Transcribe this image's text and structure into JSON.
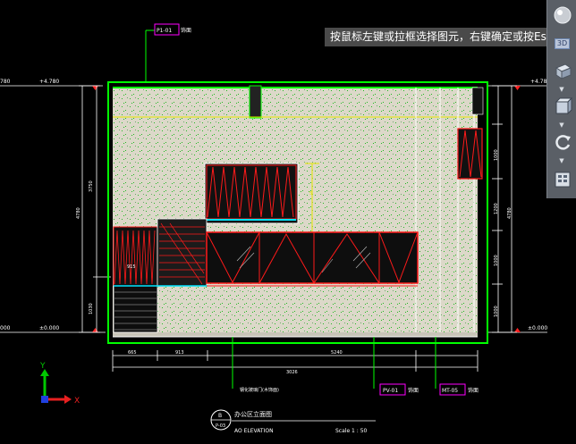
{
  "drawing": {
    "levels": {
      "top_left": "+4.780",
      "top_right": "+4.780",
      "floor_left": "±0.000",
      "floor_right": "±0.000",
      "top_left_far": "780",
      "floor_left_far": "000"
    },
    "left_dims": {
      "inner_upper": "3750",
      "outer_total": "4780",
      "inner_lower": "1030"
    },
    "right_dims": {
      "d1": "1000",
      "d2": "1200",
      "d3": "1000",
      "d4": "1000",
      "total": "4780"
    },
    "bottom_dims": {
      "d1": "665",
      "d2": "913",
      "d3": "5240",
      "d4": "3026"
    },
    "tags": {
      "top_material": "P1-01",
      "top_material_note": "饰面",
      "bottom_material_1": "PV-01",
      "bottom_material_1_note": "饰面",
      "bottom_material_2": "MT-05",
      "bottom_material_2_note": "饰面",
      "cabinet_note": "钢化玻璃门(木饰面) ",
      "panel_mark": "915"
    },
    "title_block": {
      "symbol_top": "B",
      "symbol_bottom": "P-03",
      "title_cn": "办公区立面图",
      "title_en": "AO ELEVATION",
      "scale": "Scale 1 : 50"
    },
    "ucs": {
      "y_label": "Y",
      "x_label": "X"
    },
    "colors": {
      "background": "#000000",
      "dim_white": "#ffffff",
      "frame_green": "#00ff00",
      "hatch_red": "#ff1a1a",
      "tag_magenta": "#ff00ff",
      "axis_green": "#00cc00",
      "axis_yellow": "#e6e600",
      "wall_fill": "#d9d6c8"
    }
  },
  "command_prompt": "按鼠标左键或拉框选择图元，右键确定或按Esc取消",
  "nav_bar": {
    "buttons": [
      {
        "name": "viewcube",
        "icon": "viewcube-icon"
      },
      {
        "name": "3d-view",
        "label": "3D",
        "icon": "3d-view-icon"
      },
      {
        "name": "box-view",
        "icon": "box-view-icon"
      },
      {
        "name": "cube-view",
        "icon": "cube-view-icon"
      },
      {
        "name": "orbit",
        "icon": "orbit-icon"
      },
      {
        "name": "panel",
        "icon": "panel-icon"
      }
    ]
  }
}
